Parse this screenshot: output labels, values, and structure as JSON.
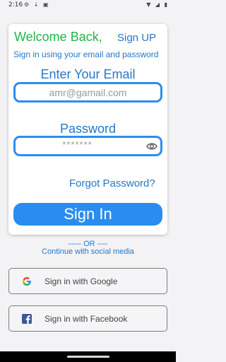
{
  "status_bar": {
    "time": "2:16",
    "left_icons": "⚙ ↓ ▣",
    "right_icons": "▼ ◢ ▮"
  },
  "header": {
    "welcome": "Welcome Back,",
    "signup_link": "Sign UP",
    "subtitle": "Sign in using your email and password"
  },
  "email": {
    "label": "Enter Your Email",
    "value": "amr@gamail.com"
  },
  "password": {
    "label": "Password",
    "masked_value": "*******",
    "toggle_icon": "eye-icon"
  },
  "forgot_password": "Forgot Password?",
  "sign_in_button": "Sign In",
  "divider": {
    "or": "----- OR ----",
    "continue": "Continue with social media"
  },
  "social": [
    {
      "label": "Sign in with Google",
      "icon": "google-icon"
    },
    {
      "label": "Sign in with Facebook",
      "icon": "facebook-icon"
    }
  ],
  "colors": {
    "green": "#23b548",
    "blue": "#2577c8",
    "accent": "#2b8cf0"
  }
}
